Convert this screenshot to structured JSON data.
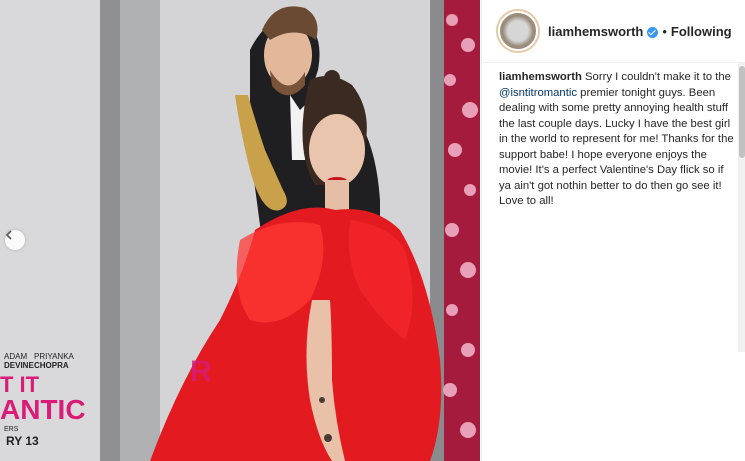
{
  "post": {
    "username": "liamhemsworth",
    "follow_status": "Following",
    "separator": "•",
    "caption": {
      "username": "liamhemsworth",
      "text_before": "Sorry I couldn't make it to the",
      "mention": "@isntitromantic",
      "text_after": "premier tonight guys. Been dealing with some pretty annoying health stuff the last couple days. Lucky I have the best girl in the world to represent for me! Thanks for the support babe! I hope everyone enjoys the movie! It's a perfect Valentine's Day flick so if ya ain't got nothin better to do then go see it! Love to all!"
    }
  },
  "poster": {
    "name1": "ADAM",
    "name1b": "DEVINE",
    "name2": "PRIYANKA",
    "name2b": "CHOPRA",
    "title1": "T IT",
    "title2": "ANTIC",
    "date": "RY 13",
    "small": "ERS"
  },
  "colors": {
    "dress": "#e31a1f",
    "lips": "#c4141c",
    "mention": "#003569",
    "verified": "#3897f0"
  }
}
